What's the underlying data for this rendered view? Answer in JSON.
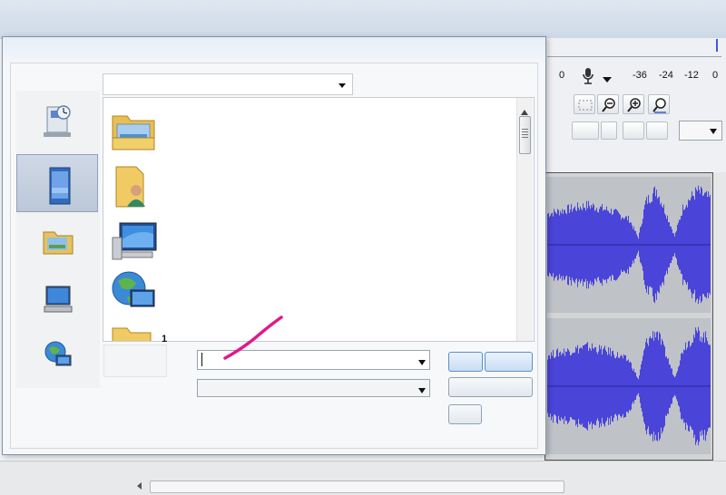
{
  "app": {
    "meter": {
      "scale_labels": [
        "0",
        "-36",
        "-24",
        "-12",
        "0"
      ]
    }
  },
  "dialog": {
    "title": "",
    "look_in_value": "",
    "filename_value": "",
    "filetype_value": "",
    "list_counter": "1",
    "buttons": {
      "open_label": "",
      "cancel_label": "",
      "help_label": ""
    }
  },
  "places": [
    {
      "icon": "recent-places-icon",
      "selected": false
    },
    {
      "icon": "desktop-icon",
      "selected": true
    },
    {
      "icon": "libraries-icon",
      "selected": false
    },
    {
      "icon": "computer-icon",
      "selected": false
    },
    {
      "icon": "network-icon",
      "selected": false
    }
  ],
  "files": [
    {
      "icon": "libraries-folder-icon"
    },
    {
      "icon": "user-folder-icon"
    },
    {
      "icon": "computer-icon"
    },
    {
      "icon": "network-icon"
    },
    {
      "icon": "folder-icon"
    }
  ],
  "colors": {
    "waveform": "#4a44d8",
    "dialog_border": "#7e93ad",
    "selection": "#c5d2e3",
    "annotation": "#e0198a"
  }
}
